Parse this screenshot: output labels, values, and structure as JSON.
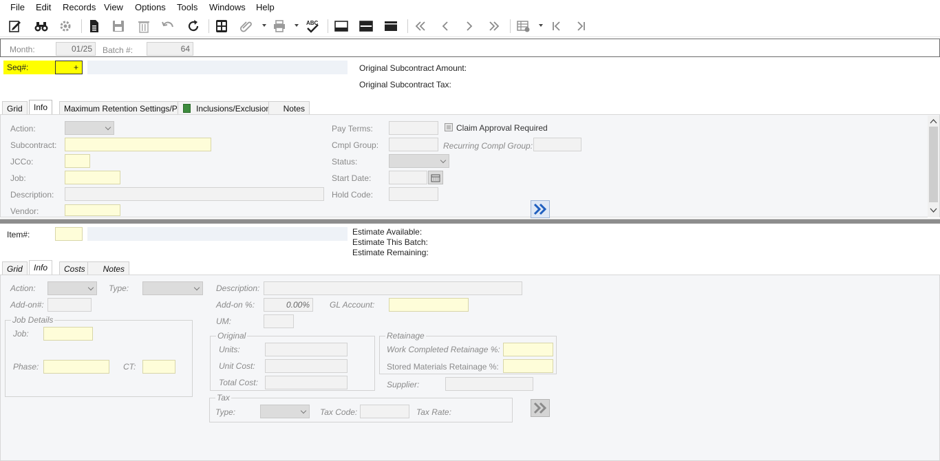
{
  "menu": [
    "File",
    "Edit",
    "Records",
    "View",
    "Options",
    "Tools",
    "Windows",
    "Help"
  ],
  "toolbar_icons": [
    "edit-form-icon",
    "binoculars-icon",
    "settings-gear-icon",
    "new-document-icon",
    "save-icon",
    "delete-icon",
    "undo-icon",
    "refresh-icon",
    "calculator-icon",
    "attachment-icon",
    "print-icon",
    "spellcheck-icon",
    "layout-top-icon",
    "layout-middle-icon",
    "layout-bottom-icon",
    "first-record-icon",
    "previous-record-icon",
    "next-record-icon",
    "last-record-icon",
    "grid-view-icon",
    "first-item-icon",
    "last-item-icon"
  ],
  "header": {
    "month_label": "Month:",
    "month_value": "01/25",
    "batch_label": "Batch #:",
    "batch_value": "64",
    "seq_label": "Seq#:",
    "seq_value": "+",
    "orig_amount_label": "Original Subcontract Amount:",
    "orig_tax_label": "Original Subcontract Tax:"
  },
  "top_tabs": [
    "Grid",
    "Info",
    "Maximum Retention Settings/PBA",
    "Inclusions/Exclusions",
    "Notes"
  ],
  "top_panel": {
    "action_label": "Action:",
    "subcontract_label": "Subcontract:",
    "jcco_label": "JCCo:",
    "job_label": "Job:",
    "description_label": "Description:",
    "vendor_label": "Vendor:",
    "pay_terms_label": "Pay Terms:",
    "claim_approval_label": "Claim Approval Required",
    "cmpl_group_label": "Cmpl Group:",
    "recurring_label": "Recurring Compl Group:",
    "status_label": "Status:",
    "start_date_label": "Start Date:",
    "hold_code_label": "Hold Code:"
  },
  "item_header": {
    "item_label": "Item#:",
    "est_available": "Estimate Available:",
    "est_batch": "Estimate This Batch:",
    "est_remaining": "Estimate Remaining:"
  },
  "bottom_tabs": [
    "Grid",
    "Info",
    "Costs",
    "Notes"
  ],
  "bottom_panel": {
    "action_label": "Action:",
    "type_label": "Type:",
    "addon_num_label": "Add-on#:",
    "description_label": "Description:",
    "addon_pct_label": "Add-on %:",
    "addon_pct_value": "0.00%",
    "gl_account_label": "GL Account:",
    "um_label": "UM:",
    "job_details_title": "Job Details",
    "job_label": "Job:",
    "phase_label": "Phase:",
    "ct_label": "CT:",
    "original_title": "Original",
    "units_label": "Units:",
    "unit_cost_label": "Unit Cost:",
    "total_cost_label": "Total Cost:",
    "retainage_title": "Retainage",
    "work_completed_label": "Work Completed Retainage %:",
    "stored_materials_label": "Stored Materials Retainage %:",
    "supplier_label": "Supplier:",
    "tax_title": "Tax",
    "tax_type_label": "Type:",
    "tax_code_label": "Tax Code:",
    "tax_rate_label": "Tax Rate:"
  },
  "colors": {
    "seq_highlight": "#ffff00",
    "required_field": "#fefdd9",
    "panel_bg": "#f5f6f8",
    "arrow_blue": "#1f5fbf"
  }
}
